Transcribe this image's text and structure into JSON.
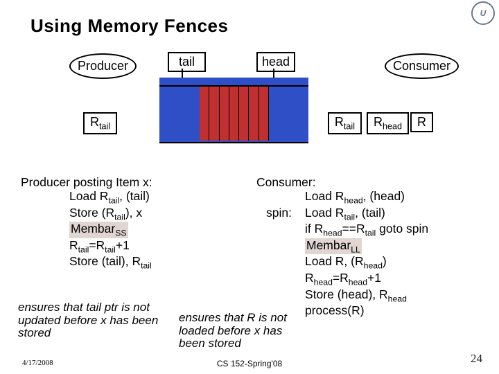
{
  "title": "Using Memory Fences",
  "logo_text": "U",
  "labels": {
    "producer": "Producer",
    "consumer": "Consumer",
    "tail": "tail",
    "head": "head",
    "rtail_html": "R<sub>tail</sub>",
    "rhead_html": "R<sub>head</sub>",
    "r": "R"
  },
  "producer_code": {
    "header": "Producer posting Item x:",
    "l1_html": "Load R<sub>tail</sub>, (tail)",
    "l2_html": "Store (R<sub>tail</sub>), x",
    "l3_html": "Membar<sub>SS</sub>",
    "l4_html": "R<sub>tail</sub>=R<sub>tail</sub>+1",
    "l5_html": "Store (tail), R<sub>tail</sub>"
  },
  "consumer_code": {
    "header": "Consumer:",
    "l1_html": "Load R<sub>head</sub>, (head)",
    "spin_label": "spin:",
    "l2_html": "Load R<sub>tail</sub>, (tail)",
    "l3_html": "if R<sub>head</sub>==R<sub>tail</sub> goto spin",
    "l4_html": "Membar<sub>LL</sub>",
    "l5_html": "Load R, (R<sub>head</sub>)",
    "l6_html": "R<sub>head</sub>=R<sub>head</sub>+1",
    "l7_html": "Store (head), R<sub>head</sub>",
    "l8_html": "process(R)"
  },
  "notes": {
    "left": "ensures that tail ptr is not updated before x has been stored",
    "mid": "ensures that R is not loaded before x has been stored"
  },
  "footer": {
    "date": "4/17/2008",
    "course": "CS 152-Spring'08",
    "page": "24"
  }
}
